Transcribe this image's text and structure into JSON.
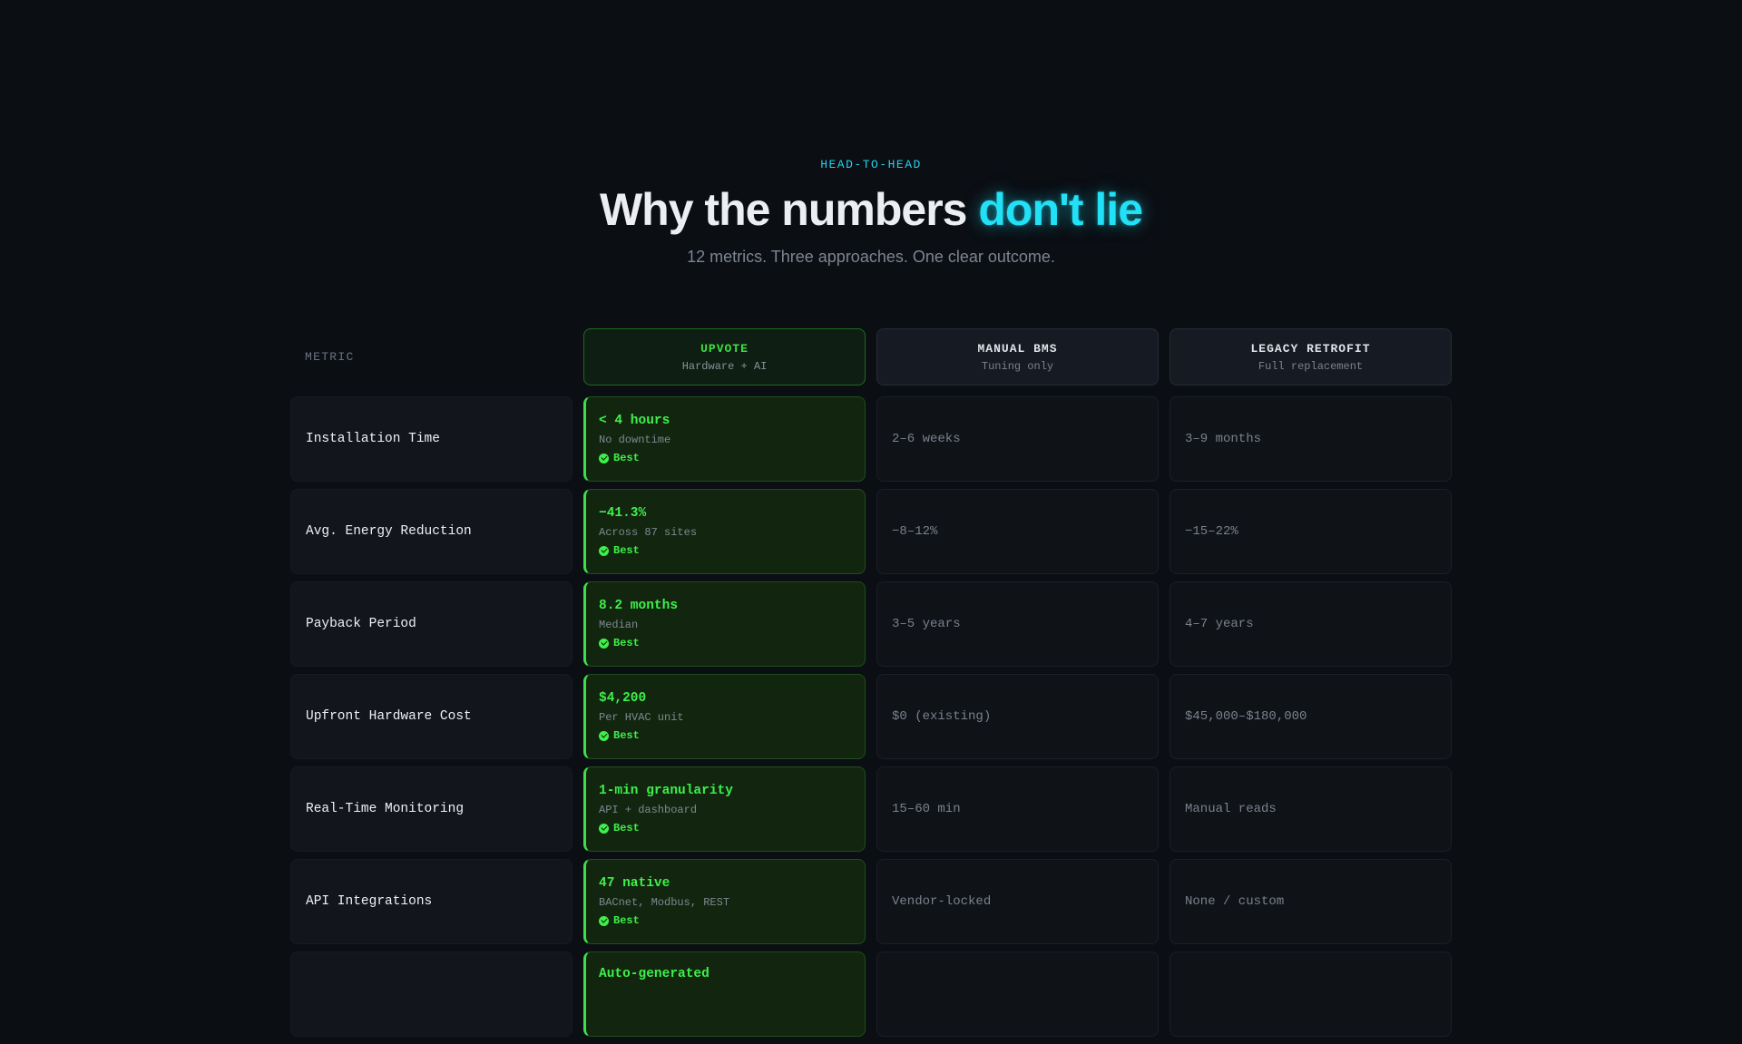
{
  "hero": {
    "eyebrow": "HEAD-TO-HEAD",
    "title_plain": "Why the numbers ",
    "title_accent": "don't lie",
    "subtitle": "12 metrics. Three approaches. One clear outcome."
  },
  "colors": {
    "background": "#0b0e13",
    "accent_cyan": "#22e0f5",
    "accent_green": "#3df04a"
  },
  "table": {
    "metric_header": "METRIC",
    "columns": [
      {
        "name": "UPVOTE",
        "sub": "Hardware + AI",
        "highlight": true
      },
      {
        "name": "MANUAL BMS",
        "sub": "Tuning only",
        "highlight": false
      },
      {
        "name": "LEGACY RETROFIT",
        "sub": "Full replacement",
        "highlight": false
      }
    ],
    "best_label": "Best",
    "best_icon": "check-circle-icon",
    "rows": [
      {
        "metric": "Installation Time",
        "upvote": {
          "value": "< 4 hours",
          "note": "No downtime",
          "best": true
        },
        "manual": "2–6 weeks",
        "legacy": "3–9 months"
      },
      {
        "metric": "Avg. Energy Reduction",
        "upvote": {
          "value": "−41.3%",
          "note": "Across 87 sites",
          "best": true
        },
        "manual": "−8–12%",
        "legacy": "−15–22%"
      },
      {
        "metric": "Payback Period",
        "upvote": {
          "value": "8.2 months",
          "note": "Median",
          "best": true
        },
        "manual": "3–5 years",
        "legacy": "4–7 years"
      },
      {
        "metric": "Upfront Hardware Cost",
        "upvote": {
          "value": "$4,200",
          "note": "Per HVAC unit",
          "best": true
        },
        "manual": "$0 (existing)",
        "legacy": "$45,000–$180,000"
      },
      {
        "metric": "Real-Time Monitoring",
        "upvote": {
          "value": "1-min granularity",
          "note": "API + dashboard",
          "best": true
        },
        "manual": "15–60 min",
        "legacy": "Manual reads"
      },
      {
        "metric": "API Integrations",
        "upvote": {
          "value": "47 native",
          "note": "BACnet, Modbus, REST",
          "best": true
        },
        "manual": "Vendor-locked",
        "legacy": "None / custom"
      },
      {
        "metric": "",
        "upvote": {
          "value": "Auto-generated",
          "note": "",
          "best": false
        },
        "manual": "",
        "legacy": ""
      }
    ]
  }
}
